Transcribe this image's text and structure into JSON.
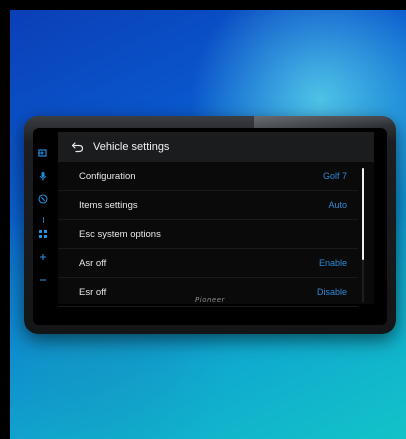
{
  "header": {
    "title": "Vehicle settings",
    "back_icon": "back-arrow-icon"
  },
  "settings": [
    {
      "label": "Configuration",
      "value": "Golf 7"
    },
    {
      "label": "Items settings",
      "value": "Auto"
    },
    {
      "label": "Esc system options",
      "value": ""
    },
    {
      "label": "Asr off",
      "value": "Enable"
    },
    {
      "label": "Esr off",
      "value": "Disable"
    }
  ],
  "scrollbar": {
    "position_fraction": 0.0,
    "visible_fraction": 0.68
  },
  "side_icons": [
    "input-icon",
    "mic-icon",
    "phone-icon",
    "apps-grid-icon",
    "volume-up-icon",
    "volume-down-icon"
  ],
  "brand": "Pioneer",
  "colors": {
    "accent": "#2f8ad8",
    "header_bg": "#1b1c1e",
    "screen_bg": "#0a0a0a"
  }
}
